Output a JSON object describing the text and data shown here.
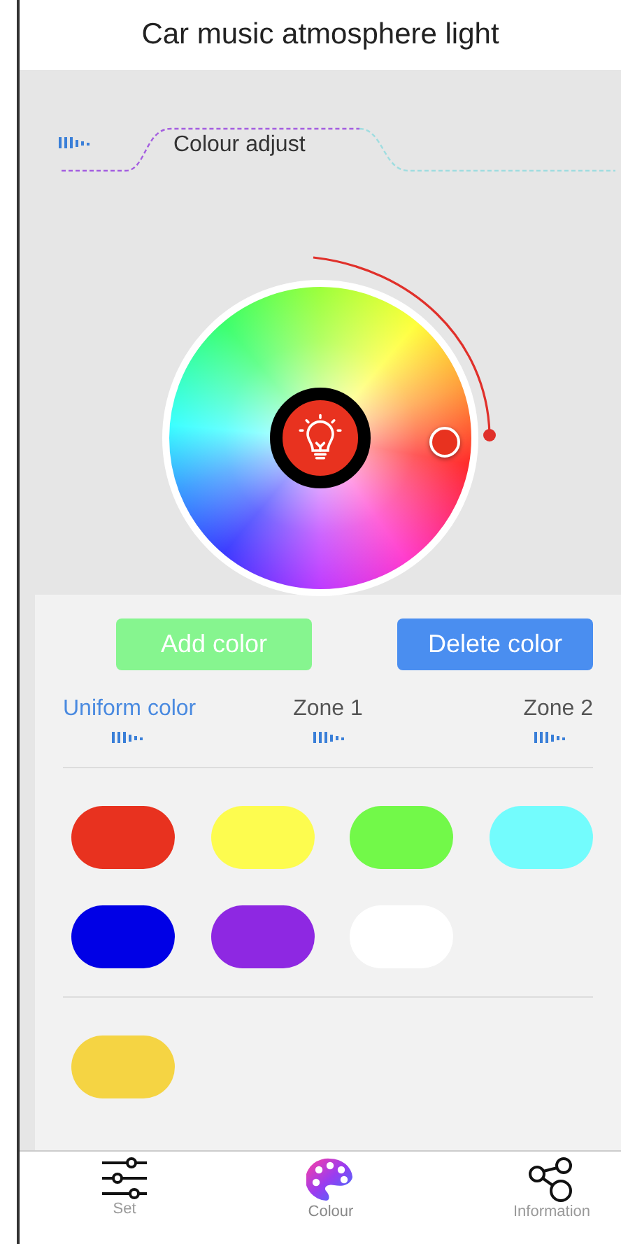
{
  "title": "Car music atmosphere light",
  "section": {
    "label": "Colour adjust"
  },
  "buttons": [
    {
      "label": "Add color",
      "kind": "add"
    },
    {
      "label": "Delete color",
      "kind": "delete"
    }
  ],
  "zones": [
    {
      "label": "Uniform color",
      "selected": true
    },
    {
      "label": "Zone 1",
      "selected": false
    },
    {
      "label": "Zone 2",
      "selected": false
    }
  ],
  "swatch_groups": [
    [
      {
        "color": "#e8321f"
      },
      {
        "color": "#fdfc4f"
      },
      {
        "color": "#72f949"
      },
      {
        "color": "#73fcfd"
      },
      {
        "color": "#0000e6"
      },
      {
        "color": "#8e28e2"
      },
      {
        "color": "#ffffff"
      }
    ],
    [
      {
        "color": "#f5d443"
      }
    ]
  ],
  "nav": [
    {
      "label": "Set",
      "kind": "sliders",
      "selected": false
    },
    {
      "label": "Colour",
      "kind": "palette",
      "selected": true
    },
    {
      "label": "Information",
      "kind": "share",
      "selected": false
    }
  ]
}
